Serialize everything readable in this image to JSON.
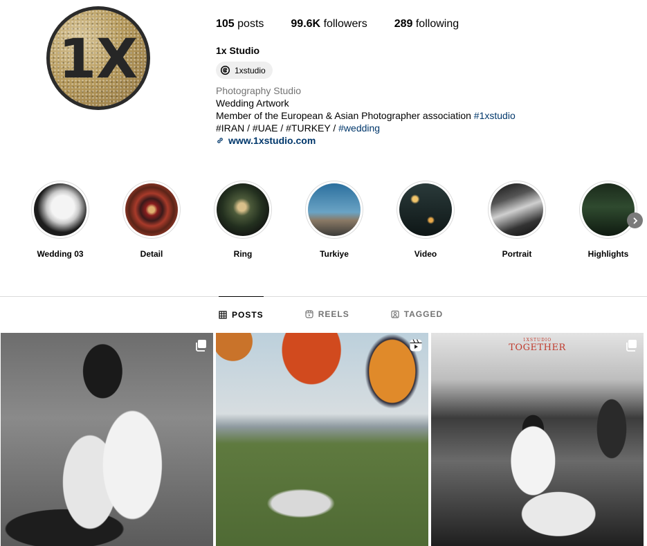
{
  "profile": {
    "logo_text": "1X",
    "stats": {
      "posts_count": "105",
      "posts_label": "posts",
      "followers_count": "99.6K",
      "followers_label": "followers",
      "following_count": "289",
      "following_label": "following"
    },
    "name": "1x Studio",
    "threads_handle": "1xstudio",
    "category": "Photography Studio",
    "bio_line1": "Wedding Artwork",
    "bio_line2_text": "Member of the European & Asian Photographer association ",
    "bio_line2_tag": "#1xstudio",
    "bio_line3_text": "#IRAN / #UAE / #TURKEY / ",
    "bio_line3_tag": "#wedding",
    "website": "www.1xstudio.com"
  },
  "highlights": [
    {
      "label": "Wedding 03"
    },
    {
      "label": "Detail"
    },
    {
      "label": "Ring"
    },
    {
      "label": "Turkiye"
    },
    {
      "label": "Video"
    },
    {
      "label": "Portrait"
    },
    {
      "label": "Highlights"
    }
  ],
  "tabs": {
    "posts": "POSTS",
    "reels": "REELS",
    "tagged": "TAGGED"
  },
  "posts": [
    {
      "type": "carousel"
    },
    {
      "type": "reel"
    },
    {
      "type": "carousel",
      "overlay_small": "1XSTUDIO",
      "overlay_title": "TOGETHER"
    }
  ],
  "colors": {
    "link": "#00376b",
    "muted": "#737373",
    "divider": "#dbdbdb",
    "overlay_red": "#c0392b"
  }
}
